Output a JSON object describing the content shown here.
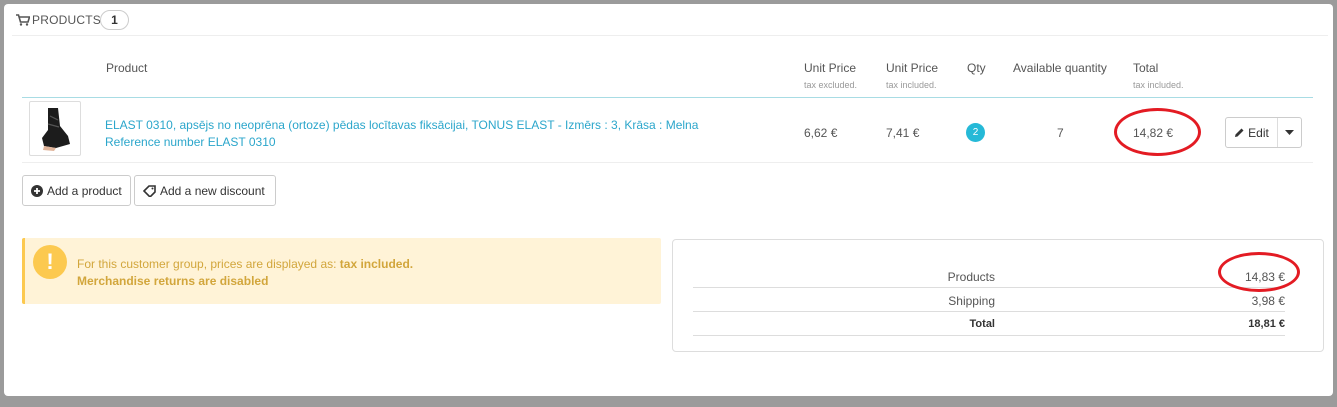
{
  "panel": {
    "title": "PRODUCTS",
    "count": "1"
  },
  "table": {
    "headers": {
      "product": "Product",
      "unit_price_excl": "Unit Price",
      "unit_price_excl_sub": "tax excluded.",
      "unit_price_incl": "Unit Price",
      "unit_price_incl_sub": "tax included.",
      "qty": "Qty",
      "available": "Available quantity",
      "total": "Total",
      "total_sub": "tax included."
    },
    "row": {
      "name_line1": "ELAST 0310, apsējs no neoprēna (ortoze) pēdas locītavas fiksācijai, TONUS ELAST - Izmērs : 3, Krāsa : Melna",
      "name_line2": "Reference number ELAST 0310",
      "unit_price_excl": "6,62 €",
      "unit_price_incl": "7,41 €",
      "qty": "2",
      "available": "7",
      "total": "14,82 €",
      "edit_label": "Edit"
    }
  },
  "actions": {
    "add_product": "Add a product",
    "add_discount": "Add a new discount"
  },
  "alert": {
    "text_prefix": "For this customer group, prices are displayed as: ",
    "text_bold": "tax included.",
    "line2": "Merchandise returns are disabled"
  },
  "totals": {
    "products_label": "Products",
    "products_value": "14,83 €",
    "shipping_label": "Shipping",
    "shipping_value": "3,98 €",
    "total_label": "Total",
    "total_value": "18,81 €"
  },
  "colors": {
    "accent": "#25b9d7",
    "link": "#2ba6cb",
    "warning_bg": "#fff3d7",
    "warning_text": "#d2a63c",
    "annotation": "#e31b23"
  }
}
